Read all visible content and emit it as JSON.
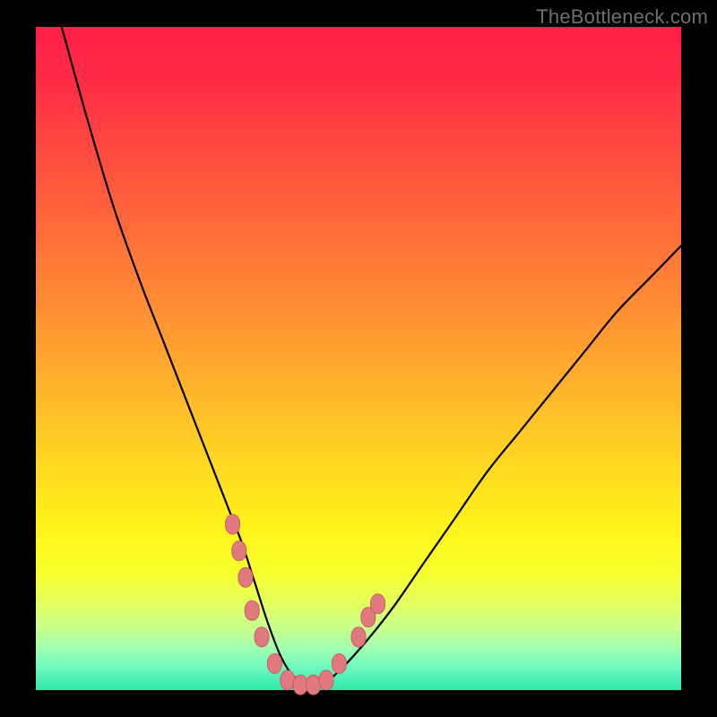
{
  "watermark": "TheBottleneck.com",
  "colors": {
    "background": "#000000",
    "gradient_top": "#ff1f47",
    "gradient_bottom": "#2ee8a8",
    "curve": "#000000",
    "marker_fill": "#e07a7f",
    "marker_stroke": "#c95d63"
  },
  "chart_data": {
    "type": "line",
    "title": "",
    "xlabel": "",
    "ylabel": "",
    "xlim": [
      0,
      100
    ],
    "ylim": [
      0,
      100
    ],
    "grid": false,
    "series": [
      {
        "name": "bottleneck-curve",
        "x": [
          4,
          8,
          12,
          16,
          20,
          24,
          28,
          30,
          32,
          34,
          36,
          38,
          40,
          42,
          44,
          46,
          50,
          55,
          60,
          65,
          70,
          75,
          80,
          85,
          90,
          95,
          100
        ],
        "y": [
          100,
          86,
          73,
          62,
          52,
          42,
          32,
          27,
          22,
          16,
          10,
          5,
          2,
          1,
          1,
          2,
          6,
          12,
          19,
          26,
          33,
          39,
          45,
          51,
          57,
          62,
          67
        ]
      }
    ],
    "markers": [
      {
        "x": 30.5,
        "y": 25
      },
      {
        "x": 31.5,
        "y": 21
      },
      {
        "x": 32.5,
        "y": 17
      },
      {
        "x": 33.5,
        "y": 12
      },
      {
        "x": 35.0,
        "y": 8
      },
      {
        "x": 37.0,
        "y": 4
      },
      {
        "x": 39.0,
        "y": 1.5
      },
      {
        "x": 41.0,
        "y": 0.8
      },
      {
        "x": 43.0,
        "y": 0.8
      },
      {
        "x": 45.0,
        "y": 1.5
      },
      {
        "x": 47.0,
        "y": 4
      },
      {
        "x": 50.0,
        "y": 8
      },
      {
        "x": 51.5,
        "y": 11
      },
      {
        "x": 53.0,
        "y": 13
      }
    ]
  }
}
